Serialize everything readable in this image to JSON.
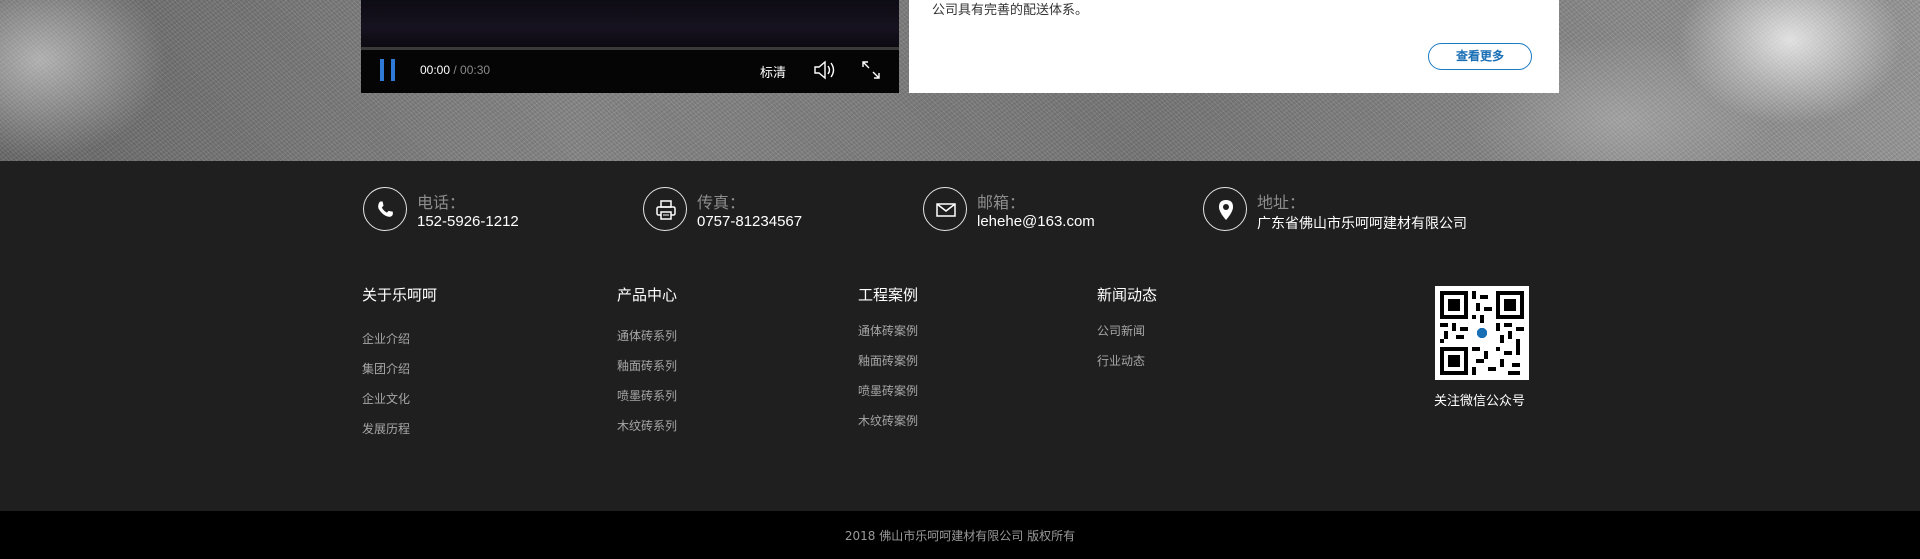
{
  "video": {
    "time_current": "00:00",
    "time_separator": " / ",
    "time_total": "00:30",
    "quality": "标清"
  },
  "intro": {
    "text": "公司具有完善的配送体系。",
    "more_label": "查看更多",
    "accent_color": "#1a7ac2"
  },
  "contacts": [
    {
      "icon": "phone-icon",
      "label": "电话：",
      "value": "152-5926-1212"
    },
    {
      "icon": "fax-icon",
      "label": "传真：",
      "value": "0757-81234567"
    },
    {
      "icon": "mail-icon",
      "label": "邮箱：",
      "value": "lehehe@163.com"
    },
    {
      "icon": "location-icon",
      "label": "地址：",
      "value": "广东省佛山市乐呵呵建材有限公司"
    }
  ],
  "columns": [
    {
      "title": "关于乐呵呵",
      "items": [
        "企业介绍",
        "集团介绍",
        "企业文化",
        "发展历程"
      ]
    },
    {
      "title": "产品中心",
      "items": [
        "通体砖系列",
        "釉面砖系列",
        "喷墨砖系列",
        "木纹砖系列"
      ]
    },
    {
      "title": "工程案例",
      "items": [
        "通体砖案例",
        "釉面砖案例",
        "喷墨砖案例",
        "木纹砖案例"
      ]
    },
    {
      "title": "新闻动态",
      "items": [
        "公司新闻",
        "行业动态"
      ]
    }
  ],
  "qr": {
    "label": "关注微信公众号"
  },
  "footer": {
    "copyright": "2018 佛山市乐呵呵建材有限公司 版权所有"
  }
}
